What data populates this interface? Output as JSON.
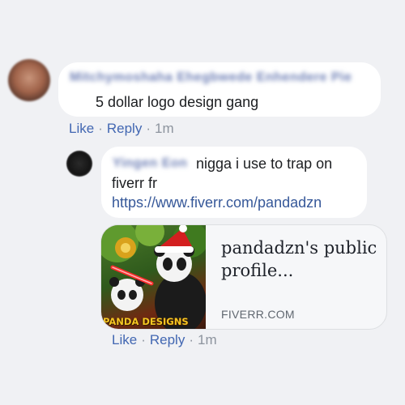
{
  "comment": {
    "author": "Mitchymoshaha Ehegbwede Enhendere Pie",
    "text": "5 dollar logo design gang",
    "actions": {
      "like": "Like",
      "reply": "Reply",
      "time": "1m"
    }
  },
  "reply": {
    "author": "Yingen Eon",
    "text_line1": "nigga i use to trap on",
    "text_line2": "fiverr fr",
    "link": "https://www.fiverr.com/pandadzn",
    "preview": {
      "title": "pandadzn's public profile...",
      "domain": "FIVERR.COM",
      "image_caption": "PANDA DESIGNS"
    },
    "actions": {
      "like": "Like",
      "reply": "Reply",
      "time": "1m"
    }
  },
  "colors": {
    "link": "#365899",
    "action": "#4267b2",
    "meta": "#8d949e",
    "background": "#f0f1f4"
  }
}
